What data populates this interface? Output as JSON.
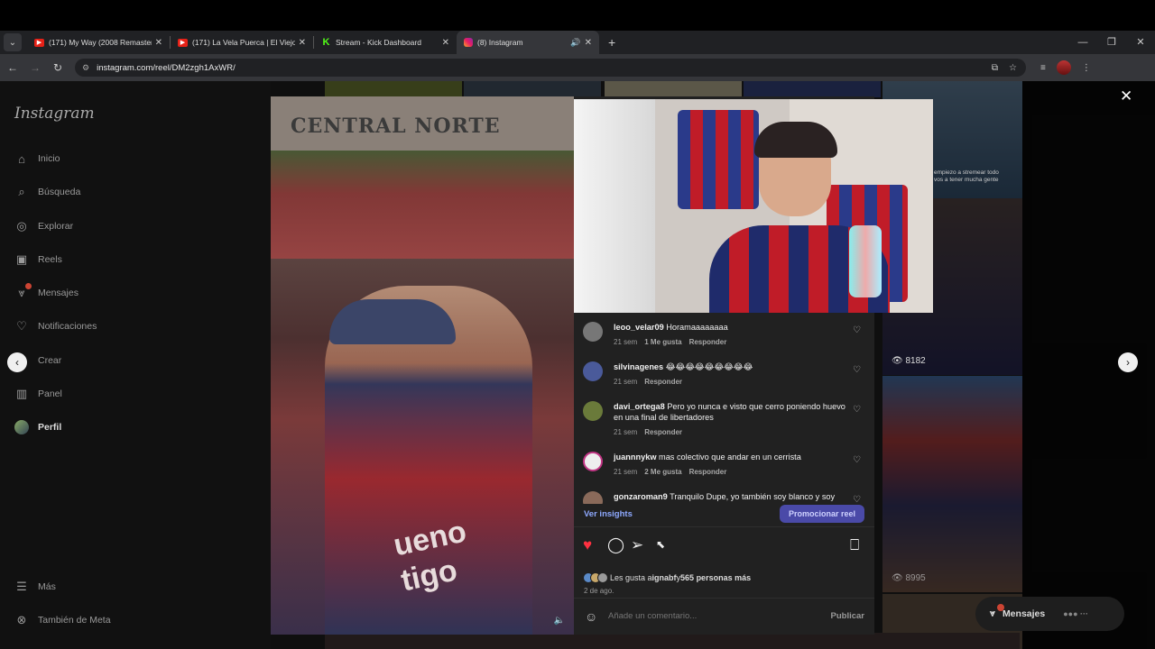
{
  "browser": {
    "tabs": [
      {
        "title": "(171) My Way (2008 Remastered)",
        "favicon": "youtube-icon",
        "active": false
      },
      {
        "title": "(171) La Vela Puerca | El Viejo | Me",
        "favicon": "youtube-icon",
        "active": false
      },
      {
        "title": "Stream - Kick Dashboard",
        "favicon": "kick-icon",
        "active": false
      },
      {
        "title": "(8) Instagram",
        "favicon": "instagram-icon",
        "active": true
      }
    ],
    "url": "instagram.com/reel/DM2zgh1AxWR/"
  },
  "sidebar": {
    "logo": "Instagram",
    "items": [
      {
        "label": "Inicio",
        "icon": "home-icon"
      },
      {
        "label": "Búsqueda",
        "icon": "search-icon"
      },
      {
        "label": "Explorar",
        "icon": "compass-icon"
      },
      {
        "label": "Reels",
        "icon": "reels-icon"
      },
      {
        "label": "Mensajes",
        "icon": "messenger-icon",
        "badge": "8"
      },
      {
        "label": "Notificaciones",
        "icon": "heart-icon"
      },
      {
        "label": "Crear",
        "icon": "plus-square-icon"
      },
      {
        "label": "Panel",
        "icon": "chart-icon"
      },
      {
        "label": "Perfil",
        "icon": "avatar"
      }
    ],
    "more": "Más",
    "meta": "También de Meta"
  },
  "reel": {
    "banner_text": "CENTRAL NORTE",
    "sponsor_line1": "ueno",
    "sponsor_line2": "tigo"
  },
  "comments": [
    {
      "user": "leoo_velar09",
      "text": "Horamaaaaaaaa",
      "time": "21 sem",
      "likes": "1 Me gusta",
      "reply": "Responder"
    },
    {
      "user": "silvinagenes",
      "text": "😂😂😂😂😂😂😂😂😂",
      "time": "21 sem",
      "likes": "",
      "reply": "Responder"
    },
    {
      "user": "davi_ortega8",
      "text": "Pero yo nunca e visto que cerro poniendo huevo en una final de libertadores",
      "time": "21 sem",
      "likes": "",
      "reply": "Responder"
    },
    {
      "user": "juannnykw",
      "text": "mas colectivo que andar en un cerrista",
      "time": "21 sem",
      "likes": "2 Me gusta",
      "reply": "Responder"
    },
    {
      "user": "gonzaroman9",
      "text": "Tranquilo Dupe, yo también soy blanco y soy",
      "time": "",
      "likes": "",
      "reply": ""
    }
  ],
  "panel": {
    "ver_insights": "Ver insights",
    "promote": "Promocionar reel",
    "likes_text_prefix": "Les gusta a ",
    "likes_user": "ignabf",
    "likes_text_mid": " y ",
    "likes_count": "565 personas más",
    "date": "2 de ago.",
    "comment_placeholder": "Añade un comentario...",
    "post": "Publicar"
  },
  "grid": {
    "views_1": "8182",
    "views_2": "8995",
    "overlay_text": "empiezo a stremear todo vos a tener mucha gente"
  },
  "messages_pill": {
    "label": "Mensajes",
    "badge": "8"
  }
}
